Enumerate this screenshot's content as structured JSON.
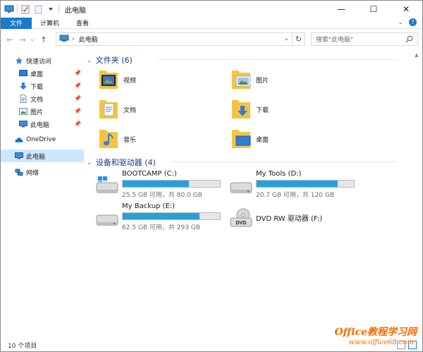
{
  "window": {
    "title": "此电脑"
  },
  "titlebar": {
    "minimize": "—",
    "maximize": "☐",
    "close": "✕"
  },
  "ribbon": {
    "file_tab": "文件",
    "tabs": [
      "计算机",
      "查看"
    ],
    "collapse_glyph": "⌄",
    "help_glyph": "?"
  },
  "address": {
    "back": "←",
    "forward": "→",
    "recent": "⌄",
    "up": "↑",
    "path_label": "此电脑",
    "refresh": "↻",
    "dropdown": "⌄"
  },
  "search": {
    "placeholder": "搜索\"此电脑\""
  },
  "nav": {
    "quick_access": "快速访问",
    "items": [
      {
        "label": "桌面",
        "icon": "desktop-icon",
        "pinned": true
      },
      {
        "label": "下载",
        "icon": "download-icon",
        "pinned": true
      },
      {
        "label": "文档",
        "icon": "document-icon",
        "pinned": true
      },
      {
        "label": "图片",
        "icon": "pictures-icon",
        "pinned": true
      },
      {
        "label": "此电脑",
        "icon": "computer-icon",
        "pinned": true
      }
    ],
    "onedrive": "OneDrive",
    "this_pc": "此电脑",
    "network": "网络"
  },
  "groups": {
    "folders": "文件夹 (6)",
    "drives": "设备和驱动器 (4)"
  },
  "folders": [
    {
      "name": "视频",
      "icon": "videos-folder-icon"
    },
    {
      "name": "图片",
      "icon": "pictures-folder-icon"
    },
    {
      "name": "文档",
      "icon": "documents-folder-icon"
    },
    {
      "name": "下载",
      "icon": "downloads-folder-icon"
    },
    {
      "name": "音乐",
      "icon": "music-folder-icon"
    },
    {
      "name": "桌面",
      "icon": "desktop-folder-icon"
    }
  ],
  "drives": [
    {
      "name": "BOOTCAMP (C:)",
      "size": "25.5 GB 可用，共 80.0 GB",
      "used_fraction": 0.68,
      "icon": "windows-drive-icon"
    },
    {
      "name": "My Tools (D:)",
      "size": "20.7 GB 可用，共 120 GB",
      "used_fraction": 0.83,
      "icon": "hard-drive-icon"
    },
    {
      "name": "My Backup (E:)",
      "size": "62.5 GB 可用，共 293 GB",
      "used_fraction": 0.79,
      "icon": "hard-drive-icon"
    },
    {
      "name": "DVD RW 驱动器 (F:)",
      "size": "",
      "used_fraction": null,
      "icon": "dvd-drive-icon"
    }
  ],
  "status": {
    "item_count": "10 个项目"
  },
  "watermark": {
    "brand": "Office教程学习网",
    "url": "www.office68.com"
  },
  "colors": {
    "accent": "#1979ca",
    "bar_fill": "#26a0da",
    "group_text": "#1e3287",
    "selected": "#cce8ff"
  }
}
